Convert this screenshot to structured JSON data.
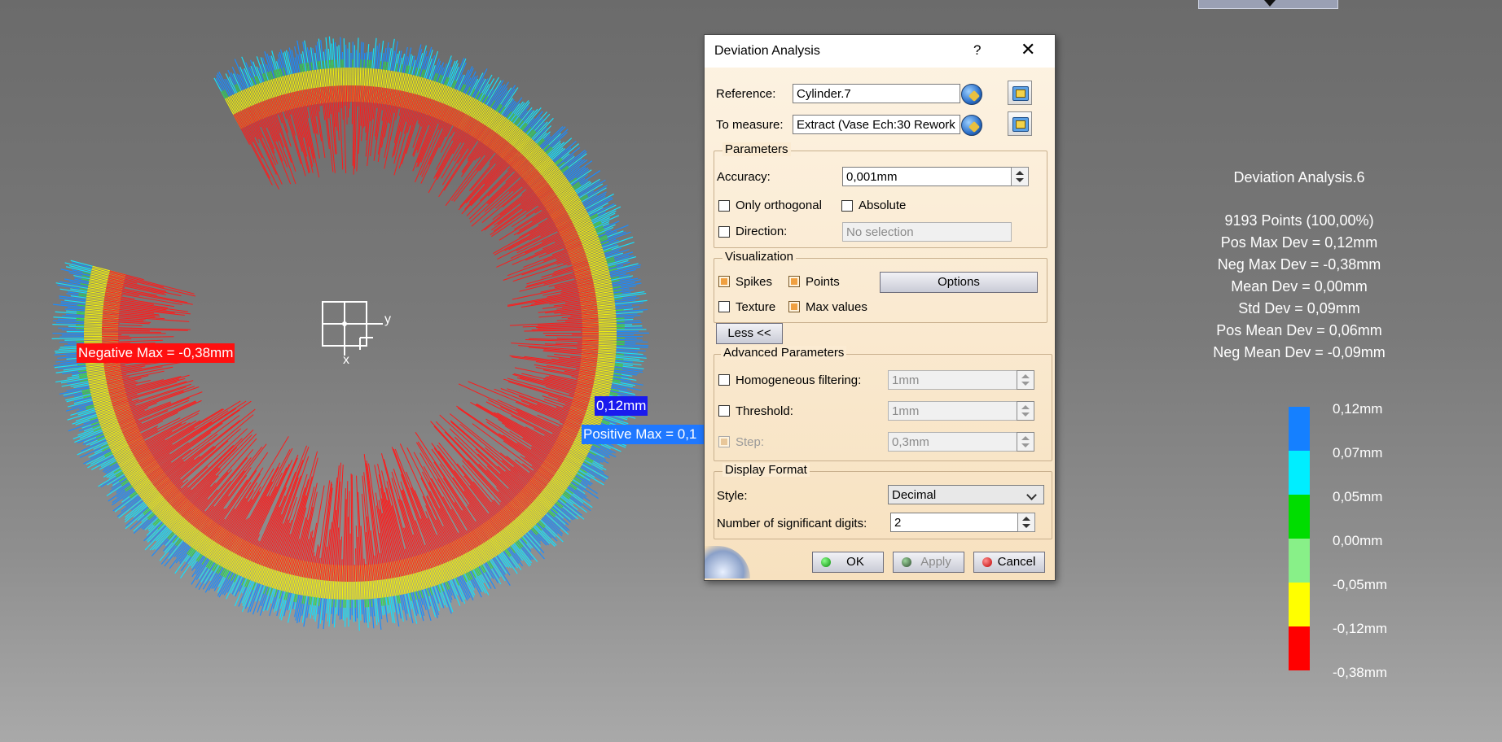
{
  "viewport": {
    "negative_max_label": "Negative Max = -0,38mm",
    "positive_max_value": "0,12mm",
    "positive_max_label": "Positive Max = 0,1",
    "axis_y": "y",
    "axis_x": "x"
  },
  "info": {
    "title": "Deviation Analysis.6",
    "points": "9193 Points (100,00%)",
    "pos_max": "Pos Max Dev = 0,12mm",
    "neg_max": "Neg Max Dev = -0,38mm",
    "mean": "Mean Dev = 0,00mm",
    "std": "Std Dev = 0,09mm",
    "pos_mean": "Pos Mean Dev = 0,06mm",
    "neg_mean": "Neg Mean Dev = -0,09mm"
  },
  "scale": {
    "labels": [
      "0,12mm",
      "0,07mm",
      "0,05mm",
      "0,00mm",
      "-0,05mm",
      "-0,12mm",
      "-0,38mm"
    ],
    "colors": [
      "#1580ff",
      "#00eeff",
      "#00dd00",
      "#88f088",
      "#ffff00",
      "#ff0000"
    ]
  },
  "dialog": {
    "title": "Deviation Analysis",
    "help": "?",
    "close": "✕",
    "reference_label": "Reference:",
    "reference_value": "Cylinder.7",
    "to_measure_label": "To measure:",
    "to_measure_value": "Extract (Vase Ech:30 Rework",
    "parameters_group": "Parameters",
    "accuracy_label": "Accuracy:",
    "accuracy_value": "0,001mm",
    "only_orthogonal": "Only orthogonal",
    "absolute": "Absolute",
    "direction_label": "Direction:",
    "direction_placeholder": "No selection",
    "visualization_group": "Visualization",
    "spikes": "Spikes",
    "points": "Points",
    "options_button": "Options",
    "texture": "Texture",
    "max_values": "Max values",
    "less_button": "Less <<",
    "advanced_group": "Advanced Parameters",
    "homog_label": "Homogeneous filtering:",
    "homog_value": "1mm",
    "threshold_label": "Threshold:",
    "threshold_value": "1mm",
    "step_label": "Step:",
    "step_value": "0,3mm",
    "display_group": "Display Format",
    "style_label": "Style:",
    "style_value": "Decimal",
    "digits_label": "Number of significant digits:",
    "digits_value": "2",
    "ok": "OK",
    "apply": "Apply",
    "cancel": "Cancel"
  }
}
